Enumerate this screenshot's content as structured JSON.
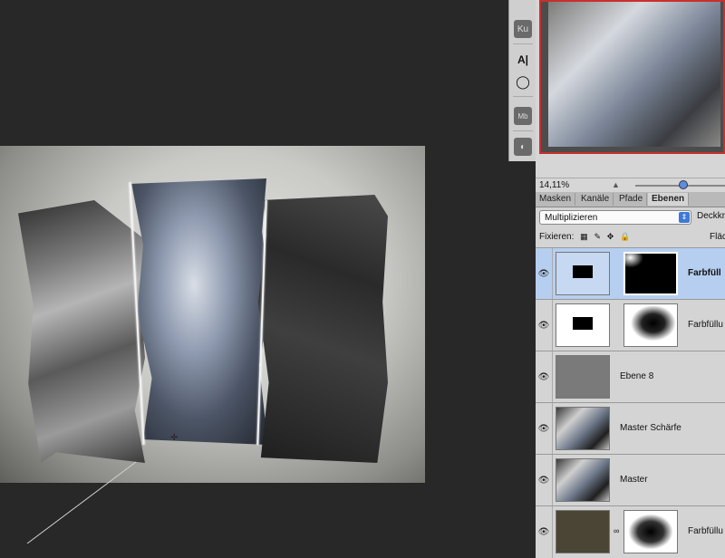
{
  "navigator": {
    "zoom": "14,11%"
  },
  "tools": [
    {
      "name": "ku-icon",
      "label": "Ku"
    },
    {
      "name": "character-text-icon",
      "label": "A|"
    },
    {
      "name": "circle-icon",
      "label": "◯"
    },
    {
      "name": "mb-icon",
      "label": "Mb"
    },
    {
      "name": "brush-icon",
      "label": "◐"
    }
  ],
  "layers_panel": {
    "tabs": [
      "Masken",
      "Kanäle",
      "Pfade",
      "Ebenen"
    ],
    "active_tab": "Ebenen",
    "blend_mode": "Multiplizieren",
    "opacity_label": "Deckkr",
    "lock_label": "Fixieren:",
    "fill_label": "Fläc",
    "layers": [
      {
        "name": "Farbfüll",
        "selected": true,
        "visible": true
      },
      {
        "name": "Farbfüllu",
        "selected": false,
        "visible": true
      },
      {
        "name": "Ebene 8",
        "selected": false,
        "visible": true
      },
      {
        "name": "Master Schärfe",
        "selected": false,
        "visible": true
      },
      {
        "name": "Master",
        "selected": false,
        "visible": true
      },
      {
        "name": "Farbfüllu",
        "selected": false,
        "visible": true
      }
    ]
  }
}
